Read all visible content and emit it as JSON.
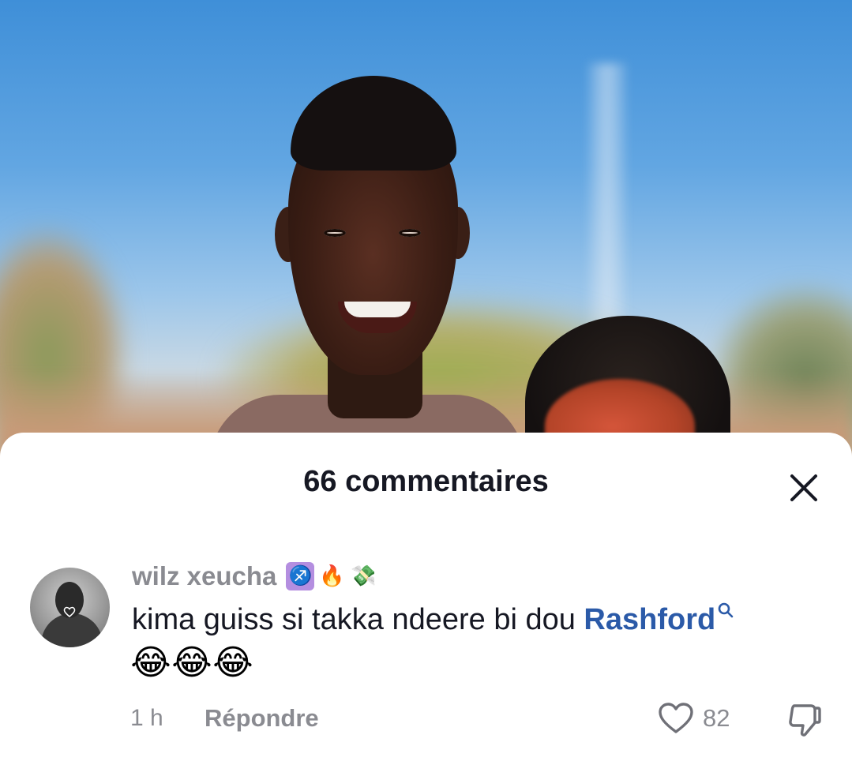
{
  "background": {
    "description_icon": "photo"
  },
  "sheet": {
    "title": "66 commentaires",
    "close_icon": "close-icon"
  },
  "comment": {
    "username": "wilz xeucha",
    "badges": [
      "♐",
      "🔥",
      "💸"
    ],
    "text": "kima guiss si takka ndeere bi dou ",
    "mention": "Rashford",
    "emojis": [
      "😂",
      "😂",
      "😂"
    ],
    "time": "1 h",
    "reply_label": "Répondre",
    "like_count": "82"
  },
  "colors": {
    "text_primary": "#161823",
    "text_secondary": "#8a8b91",
    "mention": "#2b5aa8",
    "sheet_bg": "#ffffff"
  }
}
